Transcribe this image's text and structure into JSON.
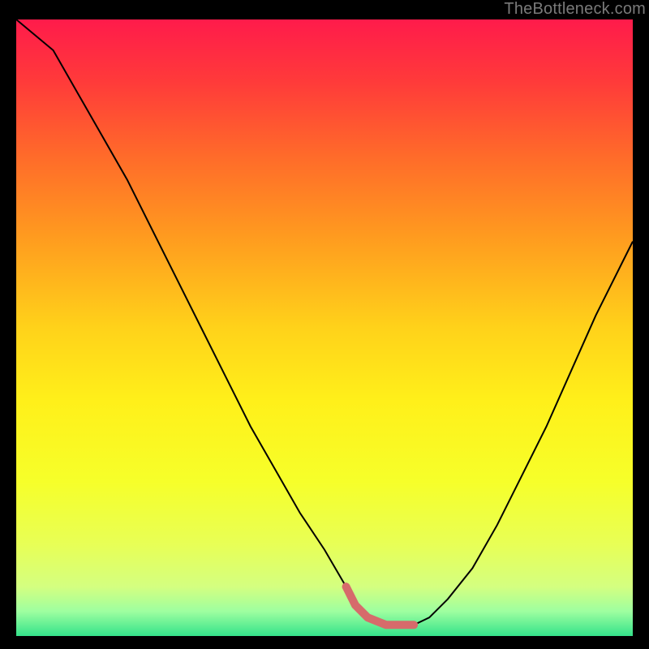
{
  "watermark": "TheBottleneck.com",
  "gradient": {
    "stops": [
      {
        "offset": 0.0,
        "color": "#ff1b4b"
      },
      {
        "offset": 0.1,
        "color": "#ff3a3a"
      },
      {
        "offset": 0.22,
        "color": "#ff6a2a"
      },
      {
        "offset": 0.35,
        "color": "#ff9a1f"
      },
      {
        "offset": 0.5,
        "color": "#ffd21a"
      },
      {
        "offset": 0.62,
        "color": "#fff01a"
      },
      {
        "offset": 0.75,
        "color": "#f6ff2a"
      },
      {
        "offset": 0.85,
        "color": "#e8ff55"
      },
      {
        "offset": 0.92,
        "color": "#d4ff80"
      },
      {
        "offset": 0.96,
        "color": "#9effa0"
      },
      {
        "offset": 1.0,
        "color": "#34e28a"
      }
    ]
  },
  "chart_data": {
    "type": "line",
    "title": "",
    "xlabel": "",
    "ylabel": "",
    "xlim": [
      0,
      100
    ],
    "ylim": [
      0,
      100
    ],
    "series": [
      {
        "name": "curve",
        "x": [
          0,
          6,
          10,
          14,
          18,
          22,
          26,
          30,
          34,
          38,
          42,
          46,
          50,
          53.5,
          55,
          57,
          60,
          63,
          64.5,
          67,
          70,
          74,
          78,
          82,
          86,
          90,
          94,
          98,
          100
        ],
        "values": [
          100,
          95,
          88,
          81,
          74,
          66,
          58,
          50,
          42,
          34,
          27,
          20,
          14,
          8,
          5,
          3,
          1.8,
          1.8,
          1.8,
          3,
          6,
          11,
          18,
          26,
          34,
          43,
          52,
          60,
          64
        ]
      },
      {
        "name": "trough-highlight",
        "x": [
          53.5,
          55,
          57,
          60,
          63,
          64.5
        ],
        "values": [
          8,
          5,
          3,
          1.8,
          1.8,
          1.8
        ]
      }
    ],
    "annotations": []
  }
}
